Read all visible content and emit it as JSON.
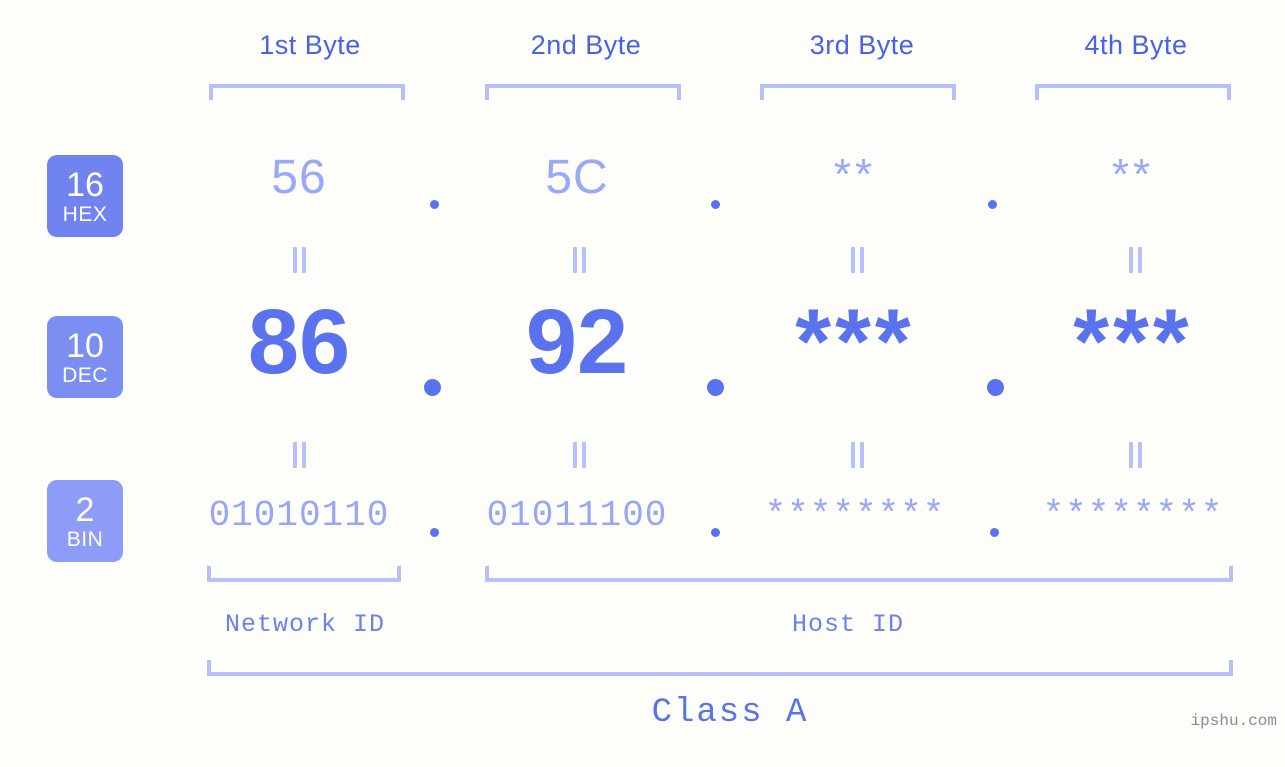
{
  "background_color": "#fdfdfa",
  "accent_color": "#5a72ee",
  "accent_light_color": "#b6c0fb",
  "byte_headers": [
    {
      "label": "1st Byte"
    },
    {
      "label": "2nd Byte"
    },
    {
      "label": "3rd Byte"
    },
    {
      "label": "4th Byte"
    }
  ],
  "rows": {
    "hex": {
      "badge_num": "16",
      "badge_base": "HEX",
      "badge_color": "#7083ef",
      "values": [
        "56",
        "5C",
        "**",
        "**"
      ]
    },
    "dec": {
      "badge_num": "10",
      "badge_base": "DEC",
      "badge_color": "#7d8ef2",
      "values": [
        "86",
        "92",
        "***",
        "***"
      ]
    },
    "bin": {
      "badge_num": "2",
      "badge_base": "BIN",
      "badge_color": "#8d9cf6",
      "values": [
        "01010110",
        "01011100",
        "********",
        "********"
      ]
    }
  },
  "separator": ".",
  "equality_symbol": "=",
  "sections": [
    {
      "label": "Network ID"
    },
    {
      "label": "Host ID"
    }
  ],
  "class_label": "Class A",
  "watermark": "ipshu.com"
}
